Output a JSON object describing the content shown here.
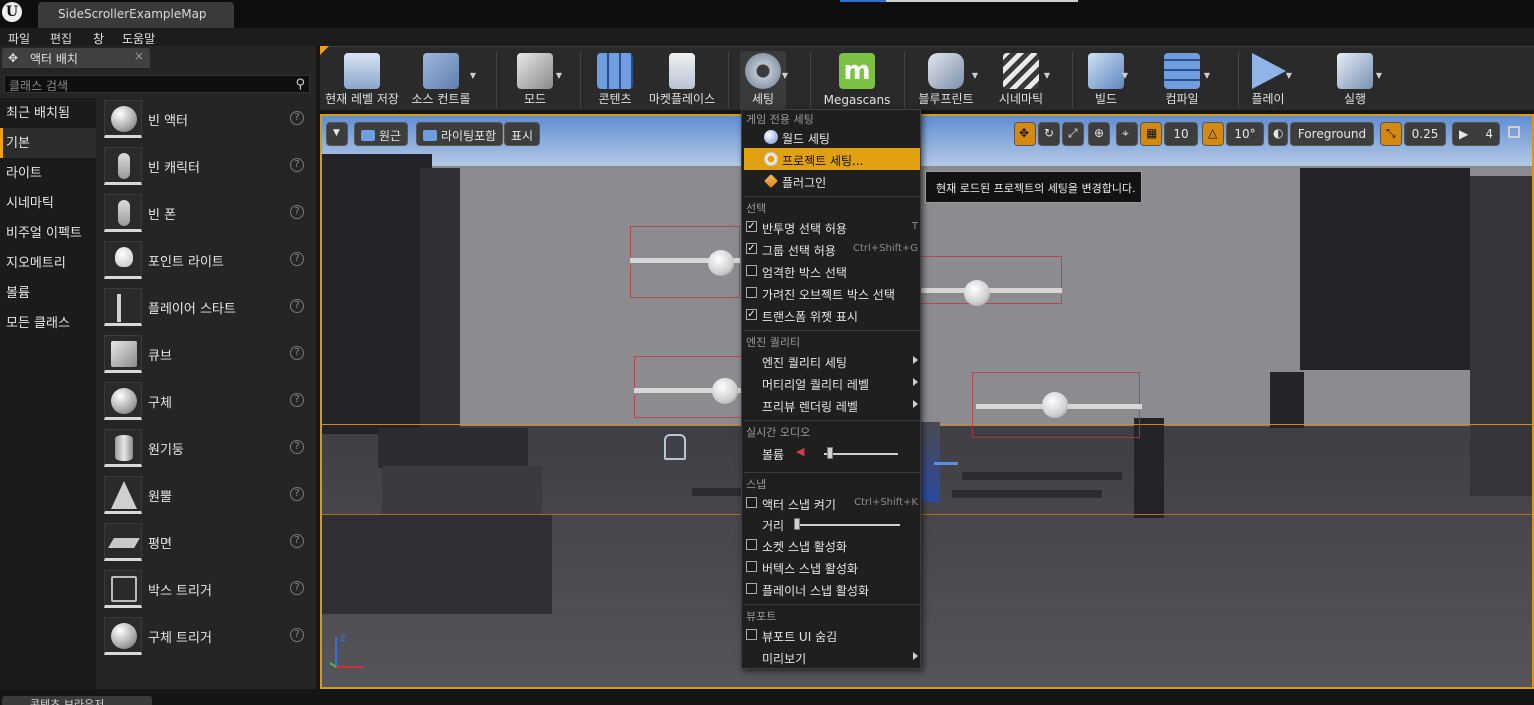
{
  "window": {
    "tab_title": "SideScrollerExampleMap"
  },
  "menubar": {
    "items": [
      "파일",
      "편집",
      "창",
      "도움말"
    ]
  },
  "left_panel": {
    "tab_title": "액터 배치",
    "search_placeholder": "클래스 검색",
    "categories": [
      "최근 배치됨",
      "기본",
      "라이트",
      "시네마틱",
      "비주얼 이펙트",
      "지오메트리",
      "볼륨",
      "모든 클래스"
    ],
    "active_category": "기본",
    "items": [
      "빈 액터",
      "빈 캐릭터",
      "빈 폰",
      "포인트 라이트",
      "플레이어 스타트",
      "큐브",
      "구체",
      "원기둥",
      "원뿔",
      "평면",
      "박스 트리거",
      "구체 트리거"
    ]
  },
  "toolbar": {
    "save": "현재 레벨 저장",
    "source_control": "소스 컨트롤",
    "modes": "모드",
    "content": "콘텐츠",
    "marketplace": "마켓플레이스",
    "settings": "세팅",
    "megascans": "Megascans",
    "blueprints": "블루프린트",
    "cinematics": "시네마틱",
    "build": "빌드",
    "compile": "컴파일",
    "play": "플레이",
    "launch": "실행"
  },
  "viewport": {
    "perspective": "원근",
    "lit": "라이팅포함",
    "show": "표시",
    "grid_snap": "10",
    "rotation_snap": "10°",
    "layer": "Foreground",
    "scale_snap": "0.25",
    "camera_speed": "4"
  },
  "settings_menu": {
    "section_game": "게임 전용 세팅",
    "world_settings": "월드 세팅",
    "project_settings": "프로젝트 세팅...",
    "plugins": "플러그인",
    "section_selection": "선택",
    "allow_translucent": "반투명 선택 허용",
    "allow_translucent_shortcut": "T",
    "allow_group": "그룹 선택 허용",
    "allow_group_shortcut": "Ctrl+Shift+G",
    "strict_box": "엄격한 박스 선택",
    "occluded_box": "가려진 오브젝트 박스 선택",
    "show_transform": "트랜스폼 위젯 표시",
    "section_quality": "엔진 퀄리티",
    "engine_quality": "엔진 퀄리티 세팅",
    "material_quality": "머티리얼 퀄리티 레벨",
    "preview_rendering": "프리뷰 렌더링 레벨",
    "section_audio": "실시간 오디오",
    "volume": "볼륨",
    "volume_level": 0.04,
    "section_snap": "스냅",
    "actor_snap": "액터 스냅 켜기",
    "actor_snap_shortcut": "Ctrl+Shift+K",
    "distance": "거리",
    "distance_level": 0.0,
    "socket_snap": "소켓 스냅 활성화",
    "vertex_snap": "버텍스 스냅 활성화",
    "planar_snap": "플레이너 스냅 활성화",
    "section_viewport": "뷰포트",
    "hide_ui": "뷰포트 UI 숨김",
    "preview": "미리보기",
    "checked": {
      "allow_translucent": true,
      "allow_group": true,
      "strict_box": false,
      "occluded_box": false,
      "show_transform": true,
      "actor_snap": false,
      "socket_snap": false,
      "vertex_snap": false,
      "planar_snap": false,
      "hide_ui": false
    }
  },
  "tooltip": "현재 로드된 프로젝트의 세팅을 변경합니다.",
  "bottom": {
    "tab": "콘텐츠 브라우저"
  },
  "colors": {
    "accent": "#f0a010",
    "highlight": "#e0a010"
  }
}
